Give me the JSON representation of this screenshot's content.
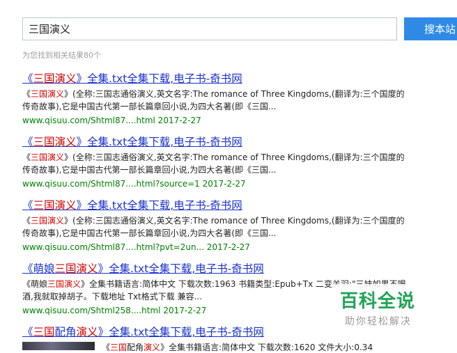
{
  "search": {
    "query": "三国演义",
    "button_label": "搜本站",
    "result_count_text": "为您找到相关结果80个"
  },
  "results": [
    {
      "title_pre": "《",
      "title_hl": "三国演义",
      "title_post": "》全集.txt全集下载,电子书-奇书网",
      "snippet_pre": "《",
      "snippet_hl": "三国演义",
      "snippet_post": "》(全称:三国志通俗演义,英文名字:The romance of Three Kingdoms,(翻译为:三个国度的传奇故事),它是中国古代第一部长篇章回小说,为四大名著(即《三国...",
      "url": "www.qisuu.com/Shtml87....html 2017-2-27"
    },
    {
      "title_pre": "《",
      "title_hl": "三国演义",
      "title_post": "》全集.txt全集下载,电子书-奇书网",
      "snippet_pre": "《",
      "snippet_hl": "三国演义",
      "snippet_post": "》(全称:三国志通俗演义,英文名字:The romance of Three Kingdoms,(翻译为:三个国度的传奇故事),它是中国古代第一部长篇章回小说,为四大名著(即《三国...",
      "url": "www.qisuu.com/Shtml87....html?source=1 2017-2-27"
    },
    {
      "title_pre": "《",
      "title_hl": "三国演义",
      "title_post": "》全集.txt全集下载,电子书-奇书网",
      "snippet_pre": "《",
      "snippet_hl": "三国演义",
      "snippet_post": "》(全称:三国志通俗演义,英文名字:The romance of Three Kingdoms,(翻译为:三个国度的传奇故事),它是中国古代第一部长篇章回小说,为四大名著(即《三国...",
      "url": "www.qisuu.com/Shtml87....html?pvt=2un... 2017-2-27"
    },
    {
      "title_pre": "《萌娘",
      "title_hl": "三国演义",
      "title_post": "》全集.txt全集下载,电子书-奇书网",
      "snippet_pre": "《萌娘",
      "snippet_hl": "三国演义",
      "snippet_post": "》全集书籍语言:简体中文 下载次数:1963 书籍类型:Epub+Tx 二变关羽:\"三妹如果不喝酒,我就取掉胡子。下载地址 Txt格式下载 兼容...",
      "url": "www.qisuu.com/Shtml258....html 2017-2-27"
    },
    {
      "title_pre": "《",
      "title_hl": "三国",
      "title_mid": "配角",
      "title_hl2": "演义",
      "title_post": "》全集.txt全集下载,电子书-奇书网",
      "snippet_pre": "《",
      "snippet_hl": "三国",
      "snippet_mid": "配角",
      "snippet_hl2": "演义",
      "snippet_post": "》全集书籍语言:简体中文 下载次数:1620 文件大小:0.34"
    }
  ],
  "watermark": {
    "main": "百科全说",
    "sub": "助你轻松解决"
  }
}
